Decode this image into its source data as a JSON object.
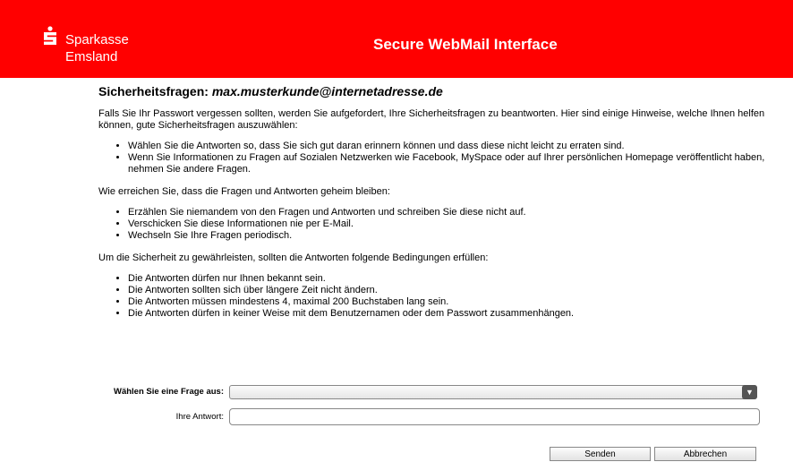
{
  "header": {
    "brand_line1": "Sparkasse",
    "brand_line2": "Emsland",
    "title": "Secure WebMail Interface",
    "color": "#ff0000"
  },
  "page": {
    "title_prefix": "Sicherheitsfragen:",
    "email": "max.musterkunde@internetadresse.de",
    "intro": "Falls Sie Ihr Passwort vergessen sollten, werden Sie aufgefordert, Ihre Sicherheitsfragen zu beantworten. Hier sind einige Hinweise, welche Ihnen helfen können, gute Sicherheitsfragen auszuwählen:",
    "tips1": [
      "Wählen Sie die Antworten so, dass Sie sich gut daran erinnern können und dass diese nicht leicht zu erraten sind.",
      "Wenn Sie Informationen zu Fragen auf Sozialen Netzwerken wie Facebook, MySpace oder auf Ihrer persönlichen Homepage veröffentlicht haben, nehmen Sie andere Fragen."
    ],
    "secret_heading": "Wie erreichen Sie, dass die Fragen und Antworten geheim bleiben:",
    "tips2": [
      "Erzählen Sie niemandem von den Fragen und Antworten und schreiben Sie diese nicht auf.",
      "Verschicken Sie diese Informationen nie per E-Mail.",
      "Wechseln Sie Ihre Fragen periodisch."
    ],
    "conditions_heading": "Um die Sicherheit zu gewährleisten, sollten die Antworten folgende Bedingungen erfüllen:",
    "conditions": [
      "Die Antworten dürfen nur Ihnen bekannt sein.",
      "Die Antworten sollten sich über längere Zeit nicht ändern.",
      "Die Antworten müssen mindestens 4, maximal 200 Buchstaben lang sein.",
      "Die Antworten dürfen in keiner Weise mit dem Benutzernamen oder dem Passwort zusammenhängen."
    ]
  },
  "form": {
    "question_label": "Wählen Sie eine Frage aus:",
    "question_value": "",
    "answer_label": "Ihre Antwort:",
    "answer_value": "",
    "submit_label": "Senden",
    "cancel_label": "Abbrechen"
  },
  "icons": {
    "logo": "sparkasse-logo-icon",
    "dropdown": "chevron-down-icon"
  }
}
